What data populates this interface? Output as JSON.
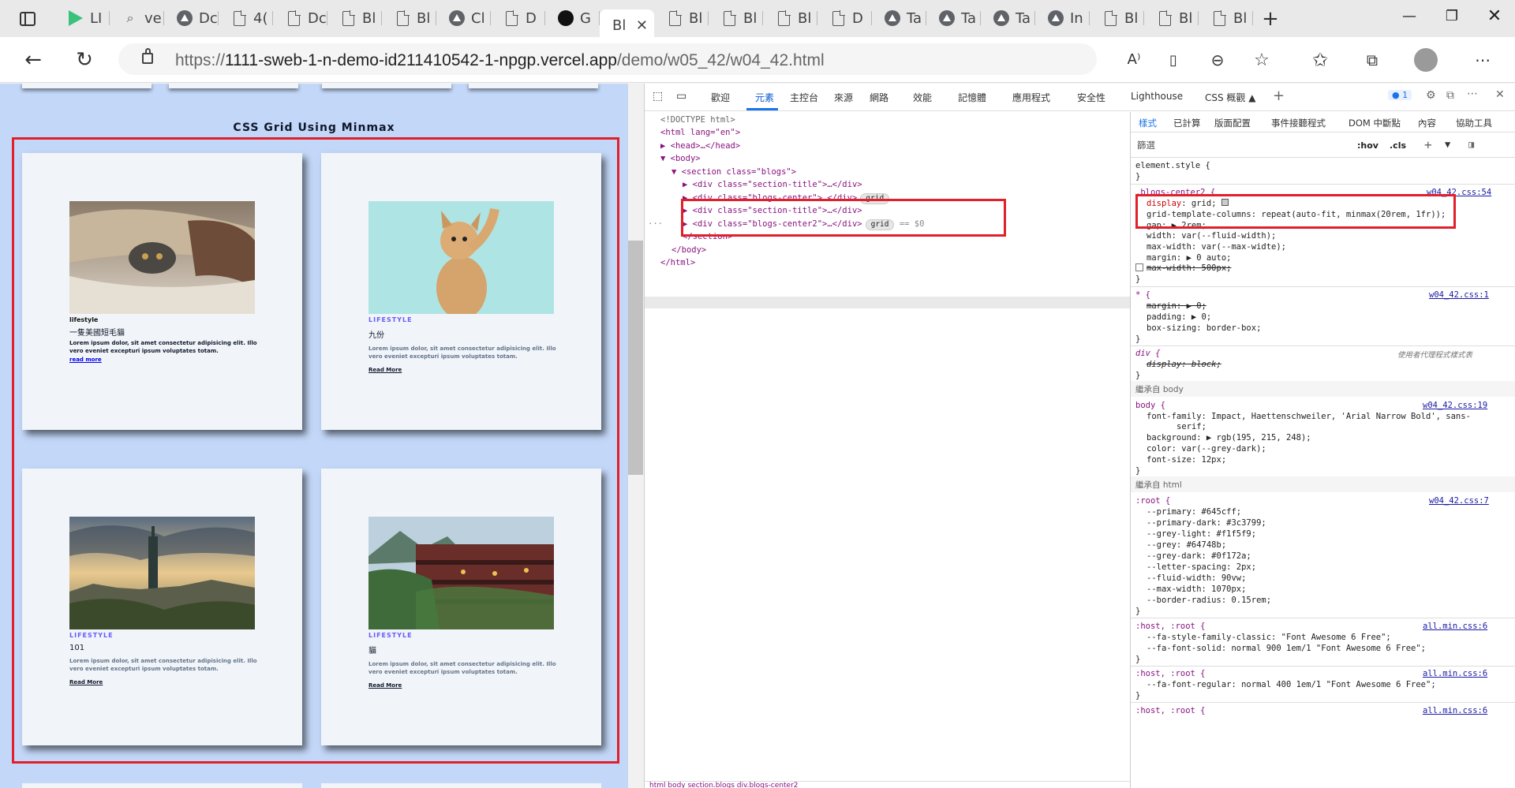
{
  "tabs": [
    {
      "label": "LI",
      "icon": "play-icon"
    },
    {
      "label": "ve",
      "icon": "search-icon"
    },
    {
      "label": "Dc",
      "icon": "triangle-icon"
    },
    {
      "label": "4(",
      "icon": "document-icon"
    },
    {
      "label": "Dc",
      "icon": "document-icon"
    },
    {
      "label": "Bl",
      "icon": "document-icon"
    },
    {
      "label": "Bl",
      "icon": "document-icon"
    },
    {
      "label": "Cl",
      "icon": "triangle-icon"
    },
    {
      "label": "D",
      "icon": "document-icon"
    },
    {
      "label": "G",
      "icon": "github-icon"
    },
    {
      "label": "Bl",
      "icon": "none",
      "active": true
    },
    {
      "label": "Bl",
      "icon": "document-icon"
    },
    {
      "label": "Bl",
      "icon": "document-icon"
    },
    {
      "label": "Bl",
      "icon": "document-icon"
    },
    {
      "label": "D",
      "icon": "document-icon"
    },
    {
      "label": "Ta",
      "icon": "triangle-icon"
    },
    {
      "label": "Ta",
      "icon": "triangle-icon"
    },
    {
      "label": "Ta",
      "icon": "triangle-icon"
    },
    {
      "label": "In",
      "icon": "triangle-icon"
    },
    {
      "label": "Bl",
      "icon": "document-icon"
    },
    {
      "label": "Bl",
      "icon": "document-icon"
    },
    {
      "label": "Bl",
      "icon": "document-icon"
    }
  ],
  "address": {
    "prefix": "https://",
    "host": "1111-sweb-1-n-demo-id211410542-1-npgp.vercel.app",
    "path": "/demo/w05_42/w04_42.html"
  },
  "page": {
    "section_title": "CSS Grid Using Minmax",
    "cards": [
      {
        "tag": "lifestyle",
        "title": "一隻美國短毛貓",
        "text": "Lorem ipsum dolor, sit amet consectetur adipisicing elit. Illo vero eveniet excepturi ipsum voluptates totam.",
        "more": "read more"
      },
      {
        "tag": "LIFESTYLE",
        "title": "九份",
        "text": "Lorem ipsum dolor, sit amet consectetur adipisicing elit. Illo vero eveniet excepturi ipsum voluptates totam.",
        "more": "Read More"
      },
      {
        "tag": "LIFESTYLE",
        "title": "101",
        "text": "Lorem ipsum dolor, sit amet consectetur adipisicing elit. Illo vero eveniet excepturi ipsum voluptates totam.",
        "more": "Read More"
      },
      {
        "tag": "LIFESTYLE",
        "title": "貓",
        "text": "Lorem ipsum dolor, sit amet consectetur adipisicing elit. Illo vero eveniet excepturi ipsum voluptates totam.",
        "more": "Read More"
      }
    ]
  },
  "devtools": {
    "tabs": [
      "歡迎",
      "元素",
      "主控台",
      "來源",
      "網路",
      "效能",
      "記憶體",
      "應用程式",
      "安全性",
      "Lighthouse",
      "CSS 概觀 ▲"
    ],
    "issues": "1",
    "dom": {
      "doctype": "<!DOCTYPE html>",
      "html_open": "<html lang=\"en\">",
      "head": "<head>…</head>",
      "body": "<body>",
      "section": "<section class=\"blogs\">",
      "div1": "<div class=\"section-title\">…</div>",
      "div2": "<div class=\"blogs-center\">…</div>",
      "div3": "<div class=\"section-title\">…</div>",
      "div4": "<div class=\"blogs-center2\">…</div>",
      "grid_badge": "grid",
      "eq": "== $0",
      "section_close": "</section>",
      "body_close": "</body>",
      "html_close": "</html>",
      "ellipsis": "···"
    },
    "breadcrumb": "html  body  section.blogs  div.blogs-center2",
    "styles_tabs": [
      "樣式",
      "已計算",
      "版面配置",
      "事件接聽程式",
      "DOM 中斷點",
      "內容",
      "協助工具"
    ],
    "filter_placeholder": "篩選",
    "hov": ":hov",
    "cls": ".cls",
    "rules": {
      "element_style": "element.style {",
      "close": "}",
      "r1_sel": ".blogs-center2 {",
      "r1_link": "w04_42.css:54",
      "r1_1": "display: grid;",
      "r1_2": "grid-template-columns: repeat(auto-fit, minmax(20rem, 1fr));",
      "r1_3": "gap: ▶ 2rem;",
      "r1_4": "width: var(--fluid-width);",
      "r1_5": "max-width: var(--max-widte);",
      "r1_6": "margin: ▶ 0 auto;",
      "r1_7": "max-width: 500px;",
      "r2_sel": "* {",
      "r2_link": "w04_42.css:1",
      "r2_1": "margin: ▶ 0;",
      "r2_2": "padding: ▶ 0;",
      "r2_3": "box-sizing: border-box;",
      "r3_sel": "div {",
      "r3_note": "使用者代理程式樣式表",
      "r3_1": "display: block;",
      "inh_body": "繼承自 body",
      "r4_sel": "body {",
      "r4_link": "w04_42.css:19",
      "r4_1": "font-family: Impact, Haettenschweiler, 'Arial Narrow Bold', sans-",
      "r4_1b": "serif;",
      "r4_2": "background: ▶ rgb(195, 215, 248);",
      "r4_3": "color: var(--grey-dark);",
      "r4_4": "font-size: 12px;",
      "inh_html": "繼承自 html",
      "r5_sel": ":root {",
      "r5_link": "w04_42.css:7",
      "r5_1": "--primary: #645cff;",
      "r5_2": "--primary-dark: #3c3799;",
      "r5_3": "--grey-light: #f1f5f9;",
      "r5_4": "--grey: #64748b;",
      "r5_5": "--grey-dark: #0f172a;",
      "r5_6": "--letter-spacing: 2px;",
      "r5_7": "--fluid-width: 90vw;",
      "r5_8": "--max-width: 1070px;",
      "r5_9": "--border-radius: 0.15rem;",
      "r6_sel": ":host, :root {",
      "r6_link": "all.min.css:6",
      "r6_1": "--fa-style-family-classic: \"Font Awesome 6 Free\";",
      "r6_2": "--fa-font-solid: normal 900 1em/1 \"Font Awesome 6 Free\";",
      "r7_sel": ":host, :root {",
      "r7_link": "all.min.css:6",
      "r7_1": "--fa-font-regular: normal 400 1em/1 \"Font Awesome 6 Free\";",
      "r8_sel": ":host, :root {",
      "r8_link": "all.min.css:6"
    }
  },
  "colors": {
    "primary": "#645cff",
    "primary_dark": "#3c3799",
    "grey_light": "#f1f5f9",
    "grey": "#64748b",
    "grey_dark": "#0f172a",
    "page_bg": "#c3d7f8",
    "highlight": "#e0202a"
  }
}
